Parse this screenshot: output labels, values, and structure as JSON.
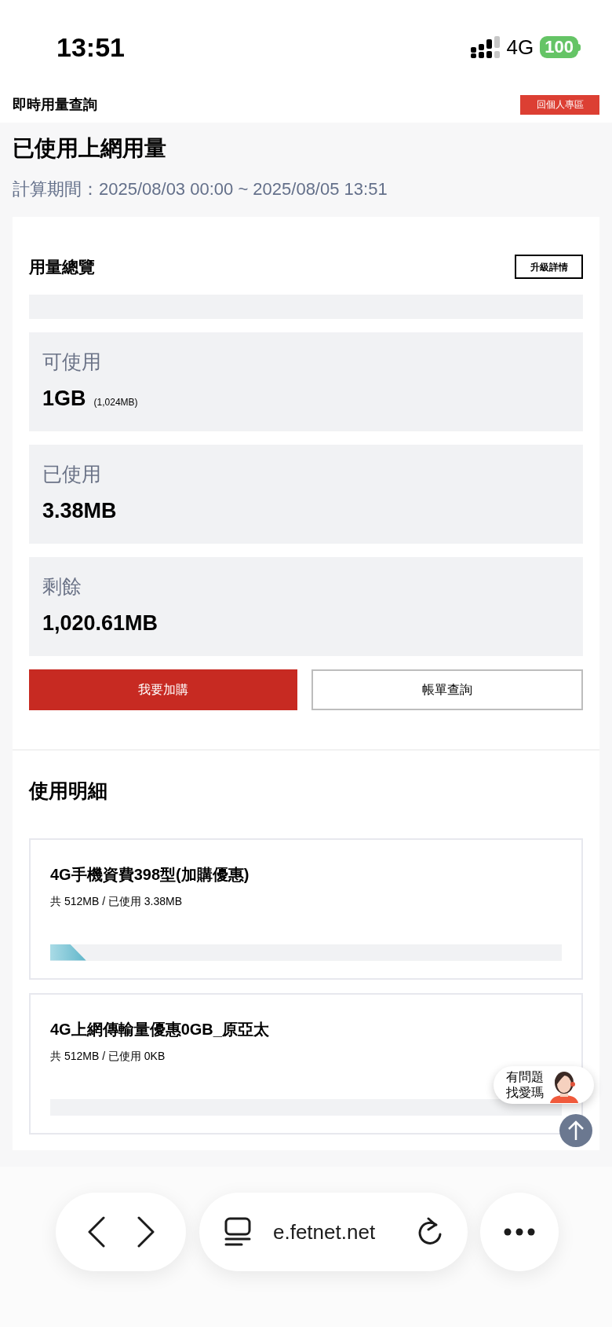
{
  "status_bar": {
    "time": "13:51",
    "network": "4G",
    "battery": "100"
  },
  "header": {
    "title": "即時用量查詢",
    "button": "回個人專區"
  },
  "page": {
    "title": "已使用上網用量",
    "period": "計算期間：2025/08/03 00:00 ~ 2025/08/05 13:51"
  },
  "overview": {
    "title": "用量總覽",
    "button": "升級詳情",
    "stats": [
      {
        "label": "可使用",
        "value": "1GB",
        "note": "(1,024MB)"
      },
      {
        "label": "已使用",
        "value": "3.38MB"
      },
      {
        "label": "剩餘",
        "value": "1,020.61MB"
      }
    ],
    "actions": [
      {
        "label": "我要加購",
        "kind": "primary"
      },
      {
        "label": "帳單查詢",
        "kind": "outline"
      }
    ]
  },
  "details": {
    "title": "使用明細",
    "items": [
      {
        "name": "4G手機資費398型(加購優惠)",
        "usage": "共 512MB / 已使用 3.38MB",
        "level": 0.07
      },
      {
        "name": "4G上網傳輸量優惠0GB_原亞太",
        "usage": "共 512MB / 已使用 0KB"
      }
    ]
  },
  "chat": {
    "line1": "有問題",
    "line2": "找愛瑪"
  },
  "browser": {
    "url": "e.fetnet.net"
  }
}
